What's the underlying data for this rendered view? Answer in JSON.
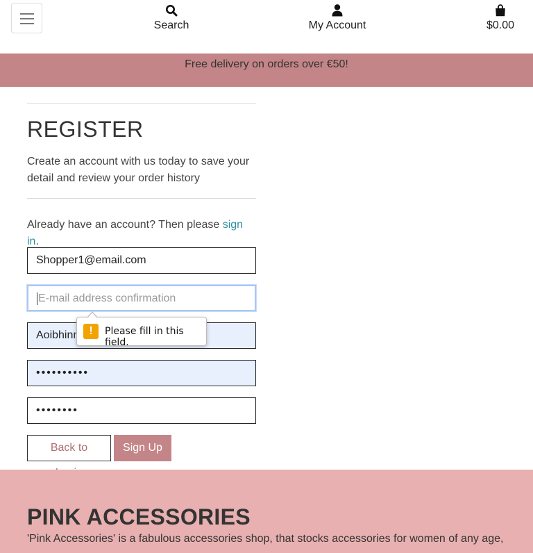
{
  "header": {
    "menu_toggle_icon": "hamburger-icon",
    "search_label": "Search",
    "search_icon": "search-icon",
    "account_label": "My Account",
    "account_icon": "user-icon",
    "bag_total": "$0.00",
    "bag_icon": "shopping-bag-icon"
  },
  "banner": {
    "text": "Free delivery on orders over €50!"
  },
  "register": {
    "title": "REGISTER",
    "description": "Create an account with us today to save your detail and review your order history",
    "signin_prefix": "Already have an account? Then please ",
    "signin_link": "sign in",
    "signin_suffix": ".",
    "fields": {
      "email_value": "Shopper1@email.com",
      "email_confirm_placeholder": "E-mail address confirmation",
      "username_value": "Aoibhinn",
      "password_value": "••••••••••",
      "password_confirm_value": "••••••••"
    },
    "validation_tooltip": "Please fill in this field.",
    "back_button": "Back to Login",
    "signup_button": "Sign Up"
  },
  "footer": {
    "title": "PINK ACCESSORIES",
    "text": "'Pink Accessories' is a fabulous accessories shop, that stocks accessories for women of any age,"
  },
  "colors": {
    "banner": "#c48588",
    "footer": "#e8b0b0",
    "link": "#2e8fa3",
    "autofill": "#e8f0fe",
    "warning": "#f2a300"
  }
}
